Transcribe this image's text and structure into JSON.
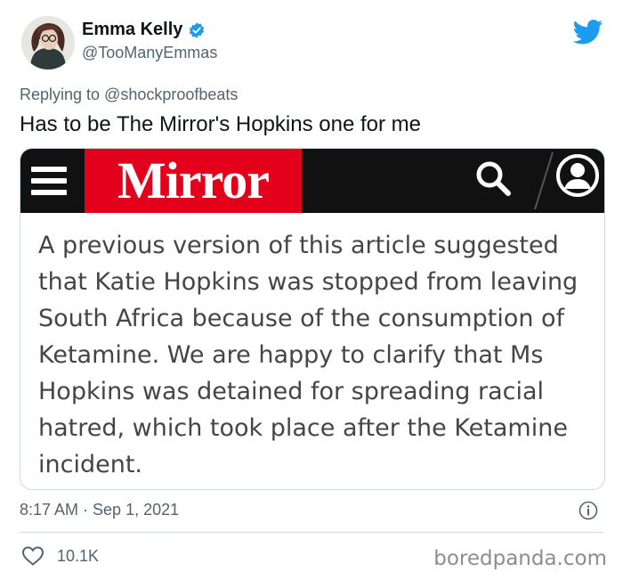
{
  "author": {
    "display_name": "Emma Kelly",
    "handle": "@TooManyEmmas"
  },
  "reply": {
    "prefix": "Replying to ",
    "mention": "@shockproofbeats"
  },
  "tweet": {
    "text": "Has to be The Mirror's Hopkins one for me"
  },
  "embedded_card": {
    "site_logo": "Mirror",
    "article_text": "A previous version of this article suggested\nthat Katie Hopkins was stopped from leaving\nSouth Africa because of the consumption of\nKetamine. We are happy to clarify that Ms\nHopkins was detained for spreading racial\nhatred, which took place after the Ketamine\nincident."
  },
  "meta": {
    "timestamp": "8:17 AM · Sep 1, 2021",
    "likes": "10.1K"
  },
  "watermark": "boredpanda.com",
  "icons": {
    "verified": "verified-badge-icon",
    "twitter": "twitter-bird-icon",
    "menu": "hamburger-menu-icon",
    "search": "search-icon",
    "user": "user-account-icon",
    "info": "info-icon",
    "like": "heart-icon"
  },
  "colors": {
    "twitter_blue": "#1d9bf0",
    "mirror_red": "#e3001b",
    "secondary_text": "#536471",
    "primary_text": "#0f1419"
  }
}
